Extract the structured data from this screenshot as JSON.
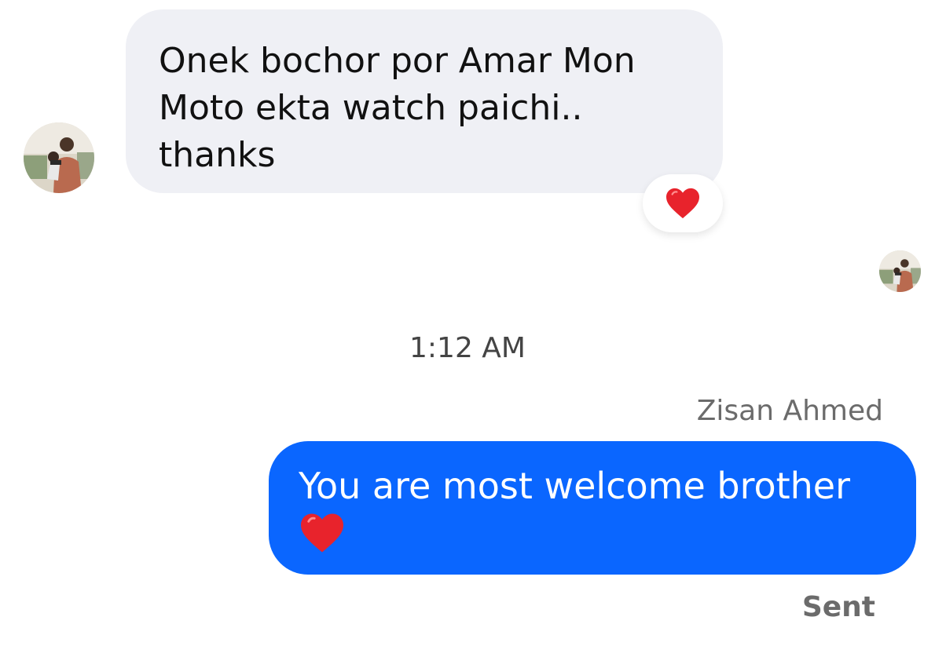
{
  "conversation": {
    "incoming_message": {
      "text": "Onek bochor por Amar Mon\nMoto ekta watch paichi..\nthanks",
      "reaction": "heart-icon"
    },
    "timestamp": "1:12 AM",
    "outgoing_message": {
      "sender_name": "Zisan Ahmed",
      "text": "You are most welcome brother",
      "emoji": "heart-icon",
      "status": "Sent"
    }
  },
  "colors": {
    "incoming_bubble": "#eff0f5",
    "outgoing_bubble": "#0a66ff",
    "heart": "#e8232c"
  }
}
